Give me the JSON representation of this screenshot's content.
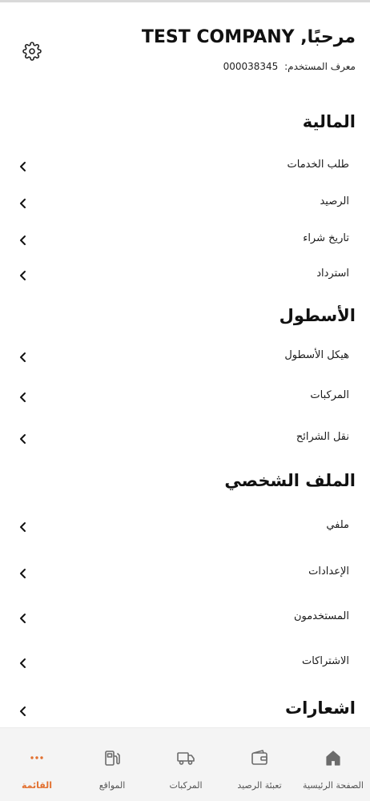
{
  "header": {
    "greeting": "مرحبًا, TEST COMPANY",
    "user_id_label": "معرف المستخدم:",
    "user_id_value": "000038345",
    "settings_icon": "gear-icon"
  },
  "sections": [
    {
      "title": "المالية",
      "items": [
        "طلب الخدمات",
        "الرصيد",
        "تاريخ شراء",
        "استرداد"
      ]
    },
    {
      "title": "الأسطول",
      "items": [
        "هيكل الأسطول",
        "المركبات",
        "نقل الشرائح"
      ]
    },
    {
      "title": "الملف الشخصي",
      "items": [
        "ملفي",
        "الإعدادات",
        "المستخدمون",
        "الاشتراكات"
      ]
    },
    {
      "title": "اشعارات",
      "items": []
    }
  ],
  "bottom_nav": {
    "items": [
      {
        "label": "الصفحة الرئيسية",
        "icon": "home-icon"
      },
      {
        "label": "تعبئة الرصيد",
        "icon": "wallet-icon"
      },
      {
        "label": "المركبات",
        "icon": "truck-icon"
      },
      {
        "label": "المواقع",
        "icon": "fuel-station-icon"
      },
      {
        "label": "القائمة",
        "icon": "more-dots-icon"
      }
    ],
    "active_index": 4
  },
  "colors": {
    "accent": "#e2702f",
    "nav_background": "#f4f4f4",
    "text": "#111111"
  }
}
